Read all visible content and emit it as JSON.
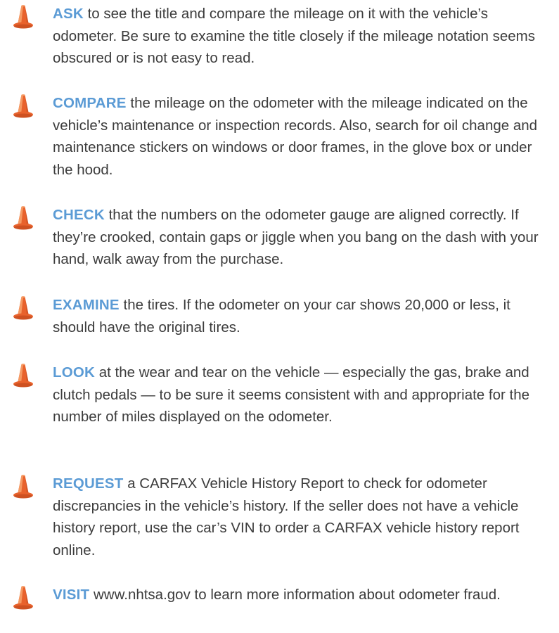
{
  "tips": [
    {
      "keyword": "ASK",
      "text": " to see the title and compare the mileage on it with the vehicle’s odometer. Be sure to examine the title closely if the mileage notation seems obscured or is not easy to read.",
      "icon": "traffic-cone-icon"
    },
    {
      "keyword": "COMPARE",
      "text": " the mileage on the odometer with the mileage indicated on the vehicle’s maintenance or inspection records. Also, search for oil change and maintenance stickers on windows or door frames, in the glove box or under the hood.",
      "icon": "traffic-cone-icon"
    },
    {
      "keyword": "CHECK",
      "text": " that the numbers on the odometer gauge are aligned correctly. If they’re crooked, contain gaps or jiggle when you bang on the dash with your hand, walk away from the purchase.",
      "icon": "traffic-cone-icon"
    },
    {
      "keyword": "EXAMINE",
      "text": " the tires. If the odometer on your car shows 20,000 or less, it should have the original tires.",
      "icon": "traffic-cone-icon"
    },
    {
      "keyword": "LOOK",
      "text": " at the wear and tear on the vehicle — especially the gas, brake and clutch pedals — to be sure it seems consistent with and appropriate for the number of miles displayed on the odometer.",
      "icon": "traffic-cone-icon"
    },
    {
      "keyword": "REQUEST",
      "text": " a CARFAX Vehicle History Report to check for odometer discrepancies in the vehicle’s history. If the seller does not have a vehicle history report, use the car’s VIN to order a CARFAX vehicle history report online.",
      "icon": "traffic-cone-icon"
    },
    {
      "keyword": "VISIT",
      "text": " www.nhtsa.gov to learn more information about odometer fraud.",
      "icon": "traffic-cone-icon"
    }
  ],
  "colors": {
    "keyword": "#5b9bd5",
    "body_text": "#3c3c3c",
    "cone_orange": "#e8622c",
    "cone_highlight": "#f59a63",
    "cone_shadow": "#b8431a"
  }
}
